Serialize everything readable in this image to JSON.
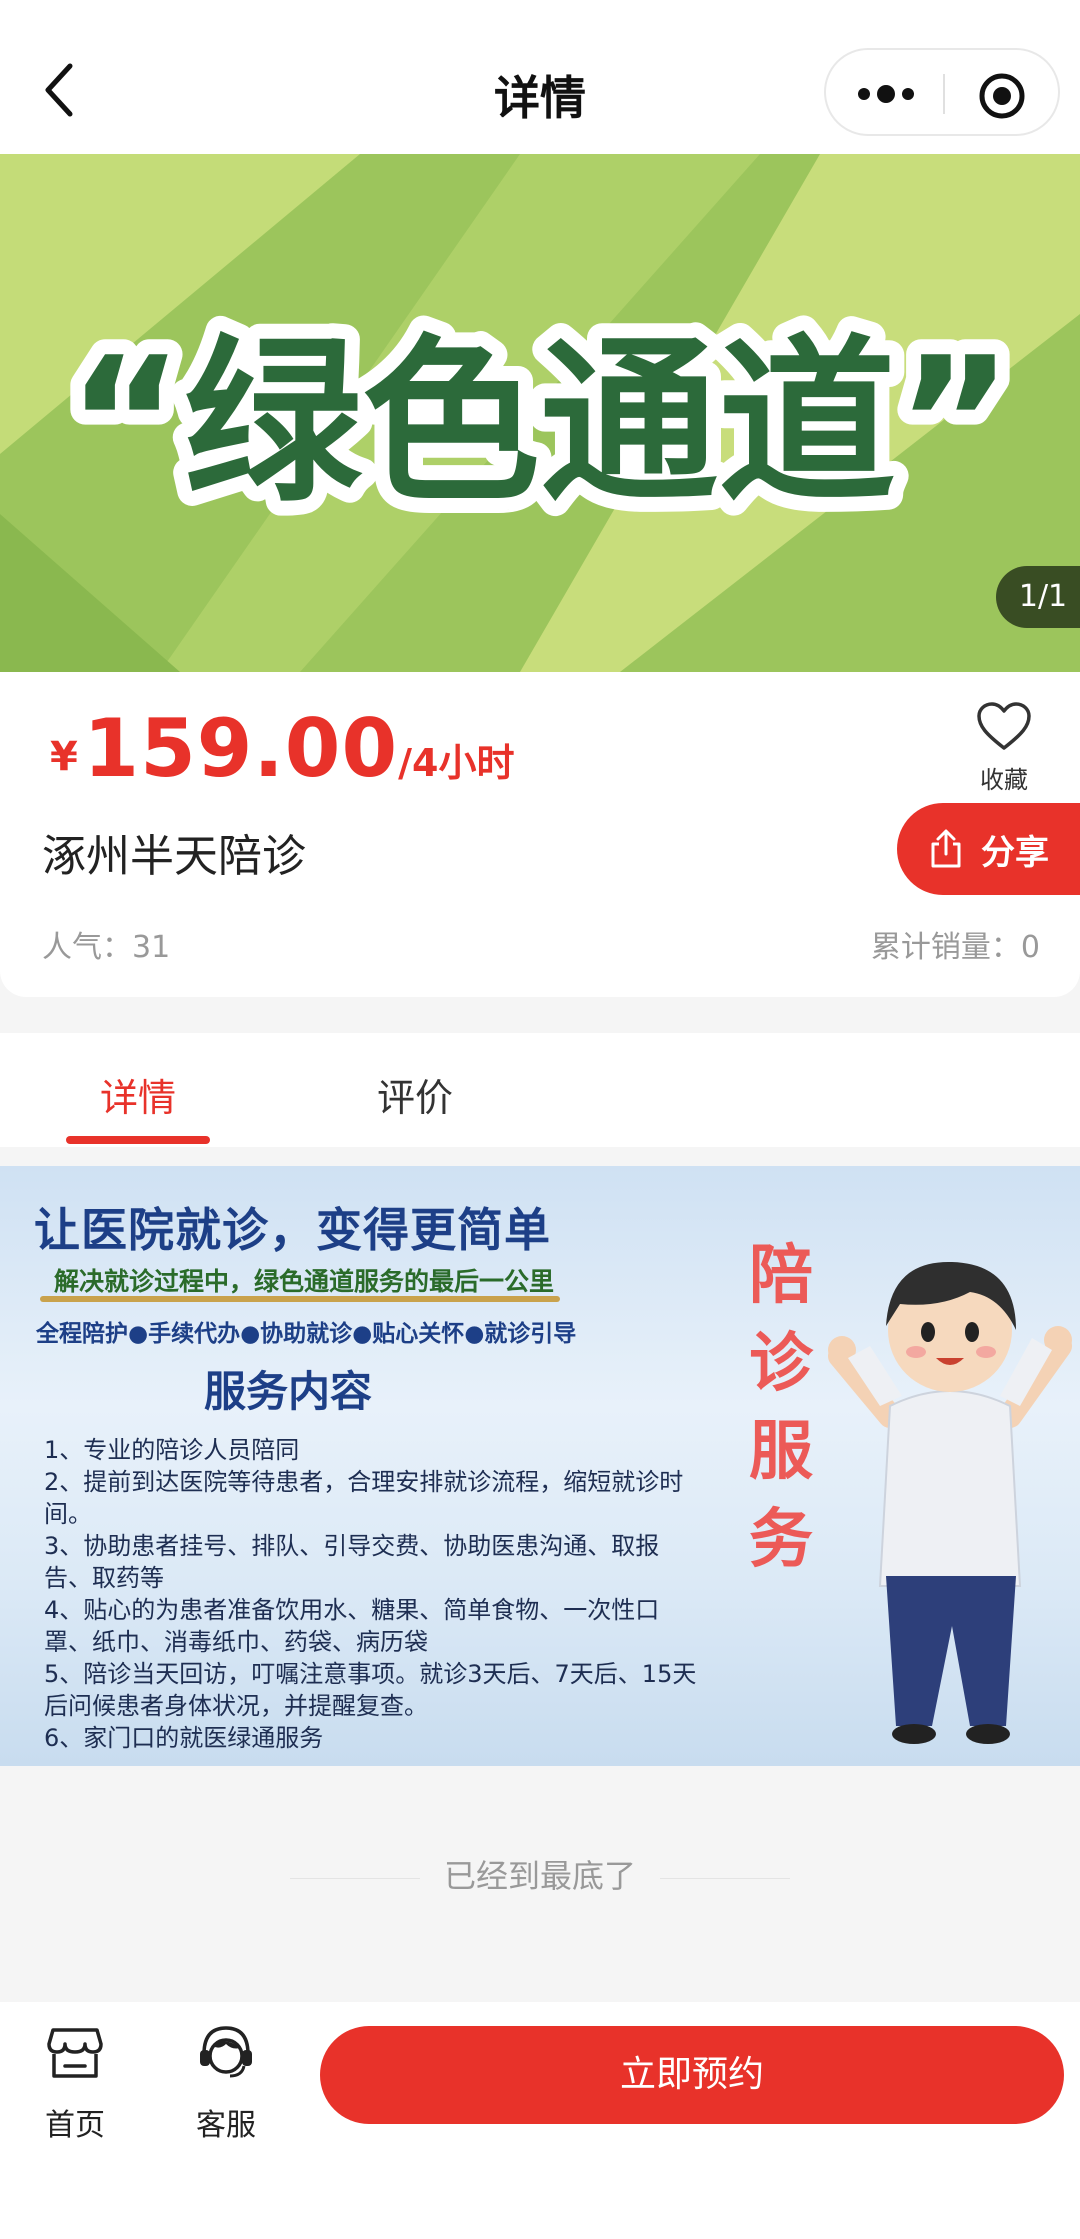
{
  "header": {
    "title": "详情",
    "back_icon": "chevron-left-icon",
    "more_icon": "more-dots-icon",
    "close_icon": "target-circle-icon"
  },
  "banner": {
    "text": "“绿色通道”",
    "pager": "1/1",
    "colors": {
      "light": "#d2e07e",
      "dark": "#8fba52",
      "text": "#2c6a3a"
    }
  },
  "product": {
    "currency": "¥",
    "price": "159.00",
    "unit": "/4小时",
    "name": "涿州半天陪诊",
    "favorite_label": "收藏",
    "share_label": "分享",
    "popularity": "人气：31",
    "sales": "累计销量：0"
  },
  "tabs": [
    {
      "label": "详情",
      "active": true
    },
    {
      "label": "评价",
      "active": false
    }
  ],
  "poster": {
    "title": "让医院就诊，变得更简单",
    "subtitle": "解决就诊过程中，绿色通道服务的最后一公里",
    "tags": "全程陪护●手续代办●协助就诊●贴心关怀●就诊引导",
    "heading": "服务内容",
    "vertical_title": "陪诊服务",
    "items": [
      "1、专业的陪诊人员陪同",
      "2、提前到达医院等待患者，合理安排就诊流程，缩短就诊时间。",
      "3、协助患者挂号、排队、引导交费、协助医患沟通、取报告、取药等",
      "4、贴心的为患者准备饮用水、糖果、简单食物、一次性口罩、纸巾、消毒纸巾、药袋、病历袋",
      "5、陪诊当天回访，叮嘱注意事项。就诊3天后、7天后、15天后问候患者身体状况，并提醒复查。",
      "6、家门口的就医绿通服务"
    ]
  },
  "end_text": "已经到最底了",
  "bottom": {
    "home_label": "首页",
    "service_label": "客服",
    "book_label": "立即预约"
  },
  "colors": {
    "accent": "#e8322a",
    "text_muted": "#999999"
  }
}
